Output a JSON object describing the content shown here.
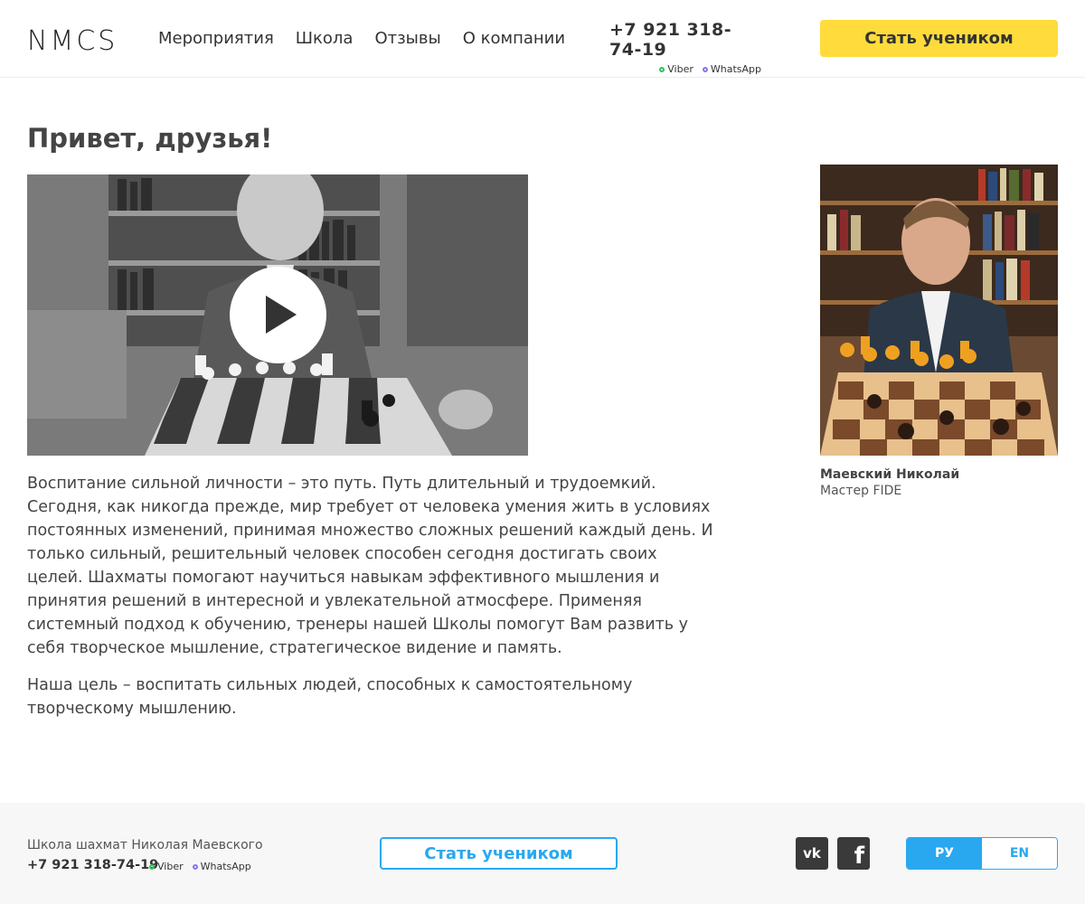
{
  "header": {
    "logo": "NMCS",
    "nav": [
      "Мероприятия",
      "Школа",
      "Отзывы",
      "О компании"
    ],
    "phone": "+7 921 318-74-19",
    "viber": "Viber",
    "whatsapp": "WhatsApp",
    "cta_label": "Стать учеником"
  },
  "main": {
    "title": "Привет, друзья!",
    "paragraph1": "Воспитание сильной личности – это путь. Путь длительный и трудоемкий. Сегодня, как никогда прежде, мир требует от человека умения жить в условиях постоянных изменений, принимая множество сложных решений каждый день. И только сильный, решительный человек способен сегодня достигать своих целей. Шахматы помогают научиться навыкам эффективного мышления и принятия решений в интересной и увлекательной атмосфере. Применяя системный подход к обучению, тренеры нашей Школы помогут Вам развить у себя творческое мышление, стратегическое видение и память.",
    "paragraph2": "Наша цель – воспитать сильных людей, способных к самостоятельному творческому мышлению.",
    "person_name": "Маевский Николай",
    "person_role": "Мастер FIDE"
  },
  "footer": {
    "school": "Школа шахмат Николая Маевского",
    "phone": "+7 921 318-74-19",
    "viber": "Viber",
    "whatsapp": "WhatsApp",
    "cta_label": "Стать учеником",
    "lang_ru": "РУ",
    "lang_en": "EN",
    "vk_text": "vk",
    "fb_text": "f"
  },
  "colors": {
    "accent_yellow": "#ffdb3b",
    "accent_blue": "#29a8f0",
    "viber_dot": "#2ec35f",
    "whatsapp_dot": "#8b73f2"
  },
  "icons": [
    "play-icon",
    "vk-icon",
    "facebook-icon",
    "dot-icon"
  ]
}
